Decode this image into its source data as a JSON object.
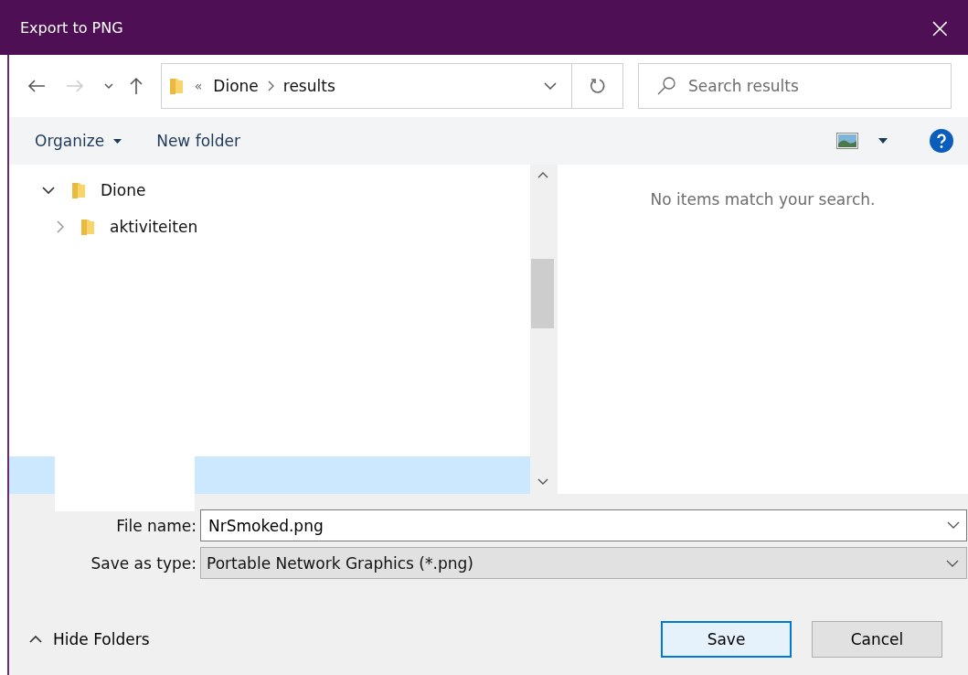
{
  "window": {
    "title": "Export to PNG",
    "close": "×"
  },
  "nav": {
    "back_disabled": false,
    "forward_disabled": true,
    "path_prefix": "«",
    "path": [
      "Dione",
      "results"
    ],
    "search": {
      "placeholder": "Search results"
    }
  },
  "toolbar": {
    "organize": "Organize",
    "new_folder": "New folder"
  },
  "tree": {
    "items": [
      {
        "label": "Dione",
        "expanded": true,
        "selected": false,
        "children": [
          {
            "label": "aktiviteiten",
            "expanded": false,
            "selected": false
          }
        ]
      }
    ]
  },
  "content": {
    "empty_message": "No items match your search."
  },
  "form": {
    "file_name": {
      "label": "File name:",
      "value": "NrSmoked.png"
    },
    "save_as_type": {
      "label": "Save as type:",
      "value": "Portable Network Graphics (*.png)"
    }
  },
  "footer": {
    "hide_folders": "Hide Folders",
    "buttons": [
      {
        "label": "Save",
        "default": true
      },
      {
        "label": "Cancel",
        "default": false
      }
    ]
  }
}
